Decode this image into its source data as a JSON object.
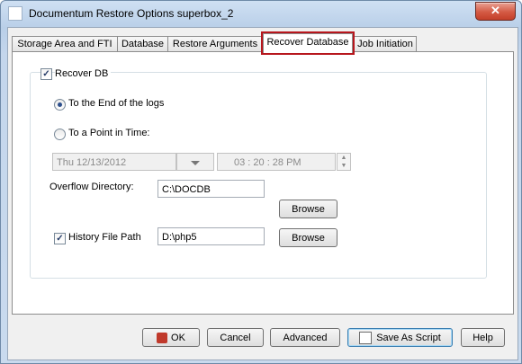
{
  "window": {
    "title": "Documentum Restore Options superbox_2",
    "close_label": "✕"
  },
  "tabs": [
    {
      "label": "Storage Area and FTI"
    },
    {
      "label": "Database"
    },
    {
      "label": "Restore Arguments"
    },
    {
      "label": "Recover Database"
    },
    {
      "label": "Job Initiation"
    }
  ],
  "recover": {
    "recover_db_label": "Recover DB",
    "recover_db_checked": true,
    "end_of_logs_label": "To the End of the logs",
    "point_in_time_label": "To a Point in Time:",
    "date_value": "Thu 12/13/2012",
    "time_value": "03 : 20 : 28 PM",
    "overflow_label": "Overflow Directory:",
    "overflow_value": "C:\\DOCDB",
    "browse_label": "Browse",
    "history_label": "History File Path",
    "history_checked": true,
    "history_value": "D:\\php5"
  },
  "buttons": {
    "ok": "OK",
    "cancel": "Cancel",
    "advanced": "Advanced",
    "save_script": "Save As Script",
    "help": "Help"
  },
  "colors": {
    "highlight_tab_border": "#b7161d",
    "title_gradient": "#cfe0f3"
  }
}
